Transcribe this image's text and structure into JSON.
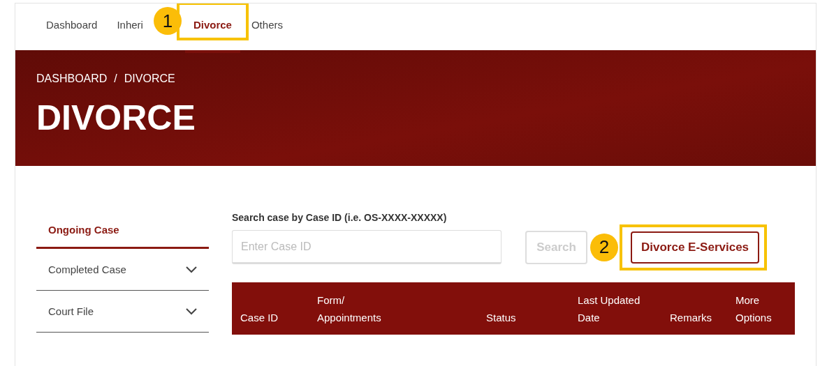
{
  "nav": {
    "tabs": [
      {
        "label": "Dashboard",
        "selected": false
      },
      {
        "label": "Inheri",
        "selected": false
      },
      {
        "label": "Divorce",
        "selected": true,
        "callout": "1"
      },
      {
        "label": "Others",
        "selected": false
      }
    ]
  },
  "banner": {
    "breadcrumb": [
      {
        "label": "DASHBOARD"
      },
      {
        "label": "/"
      },
      {
        "label": "DIVORCE"
      }
    ],
    "title": "DIVORCE"
  },
  "sidebar": {
    "items": [
      {
        "label": "Ongoing Case",
        "selected": true,
        "expandable": false
      },
      {
        "label": "Completed Case",
        "selected": false,
        "expandable": true
      },
      {
        "label": "Court File",
        "selected": false,
        "expandable": true
      }
    ]
  },
  "search": {
    "label": "Search case by Case ID (i.e. OS-XXXX-XXXXX)",
    "placeholder": "Enter Case ID",
    "button": {
      "label": "Search",
      "disabled": true
    }
  },
  "eservices_button": {
    "label": "Divorce E-Services",
    "callout": "2"
  },
  "table": {
    "columns": [
      "Case ID",
      "Form/ Appointments",
      "Status",
      "Last Updated Date",
      "Remarks",
      "More Options"
    ]
  }
}
